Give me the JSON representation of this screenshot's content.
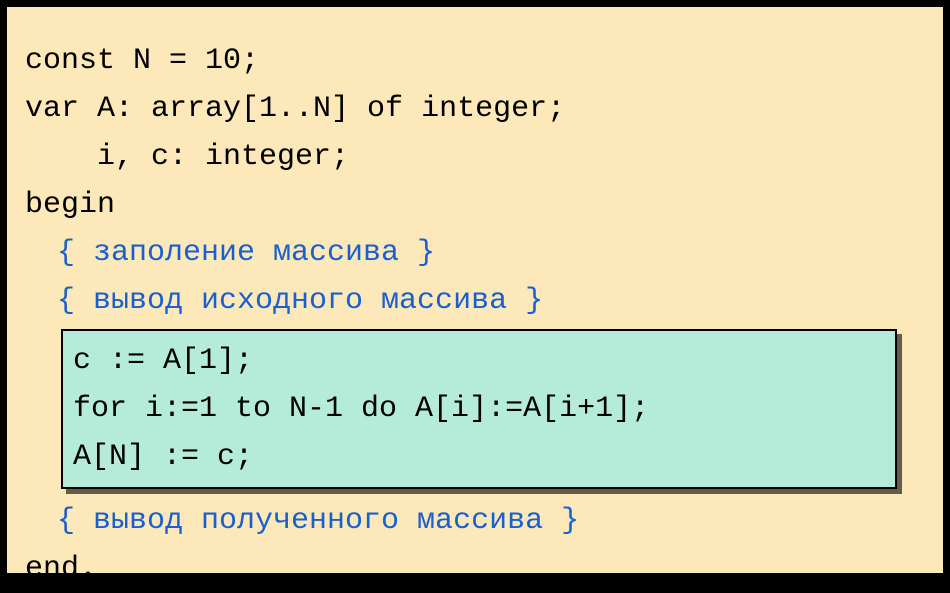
{
  "code": {
    "line1": "const N = 10;",
    "line2": "var A: array[1..N] of integer;",
    "line3": "    i, c: integer;",
    "line4": "begin",
    "comment1": "{ заполение массива }",
    "comment2": "{ вывод исходного массива }",
    "hl1": "c := A[1];",
    "hl2": "for i:=1 to N-1 do A[i]:=A[i+1];",
    "hl3": "A[N] := c;",
    "comment3": "{ вывод полученного массива }",
    "line_end": "end."
  }
}
